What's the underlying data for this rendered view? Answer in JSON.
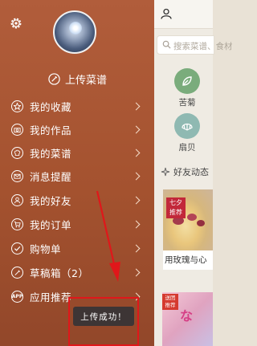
{
  "drawer": {
    "upload_label": "上传菜谱",
    "menu": [
      {
        "label": "我的收藏",
        "icon": "star-icon"
      },
      {
        "label": "我的作品",
        "icon": "camera-icon"
      },
      {
        "label": "我的菜谱",
        "icon": "chef-hat-icon"
      },
      {
        "label": "消息提醒",
        "icon": "envelope-icon"
      },
      {
        "label": "我的好友",
        "icon": "person-icon"
      },
      {
        "label": "我的订单",
        "icon": "cart-icon"
      },
      {
        "label": "购物单",
        "icon": "check-icon"
      },
      {
        "label": "草稿箱（2）",
        "icon": "draft-icon"
      },
      {
        "label": "应用推荐",
        "icon": "app-icon",
        "icon_text": "APP"
      }
    ]
  },
  "main": {
    "search_placeholder": "搜索菜谱、食材",
    "categories": [
      {
        "label": "苦菊",
        "color": "#7aac7c"
      },
      {
        "label": "扇贝",
        "color": "#8fb9b2"
      }
    ],
    "friends_header": "好友动态",
    "card1": {
      "badge_line1": "七夕",
      "badge_line2": "推荐",
      "title": "用玫瑰与心"
    },
    "card2": {
      "badge_line1": "送团",
      "badge_line2": "推荐",
      "deco": "な"
    }
  },
  "toast": {
    "text": "上传成功！"
  },
  "colors": {
    "drawer": "#a4522f",
    "accent_red": "#e0171a",
    "toast_bg": "#3d3535"
  }
}
